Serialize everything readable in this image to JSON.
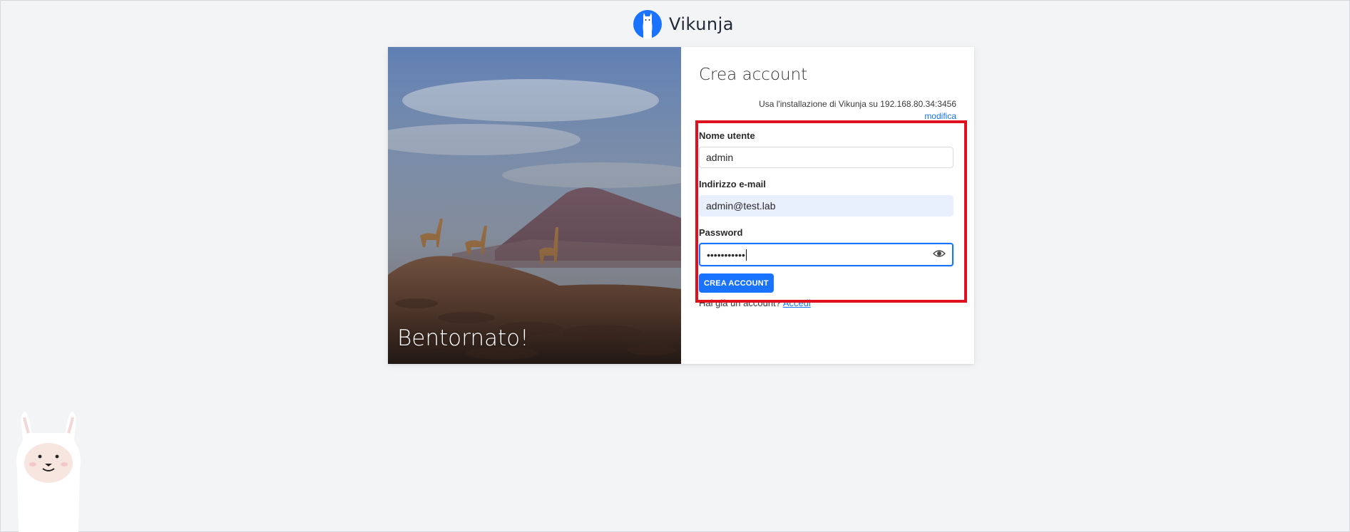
{
  "app": {
    "name": "Vikunja",
    "logo_icon": "llama-logo-icon",
    "brand_color": "#1973ff"
  },
  "hero": {
    "title": "Bentornato!"
  },
  "register": {
    "title": "Crea account",
    "server_note": "Usa l'installazione di Vikunja su 192.168.80.34:3456",
    "edit_label": "modifica",
    "username": {
      "label": "Nome utente",
      "value": "admin"
    },
    "email": {
      "label": "Indirizzo e-mail",
      "value": "admin@test.lab"
    },
    "password": {
      "label": "Password",
      "value": "•••••••••••",
      "toggle_icon": "eye-icon"
    },
    "submit_label": "CREA ACCOUNT",
    "signin_prompt": "Hai già un account?",
    "signin_link": "Accedi"
  },
  "colors": {
    "highlight": "#e0111f",
    "background": "#f3f4f6",
    "autofill": "#e8f0fe"
  }
}
